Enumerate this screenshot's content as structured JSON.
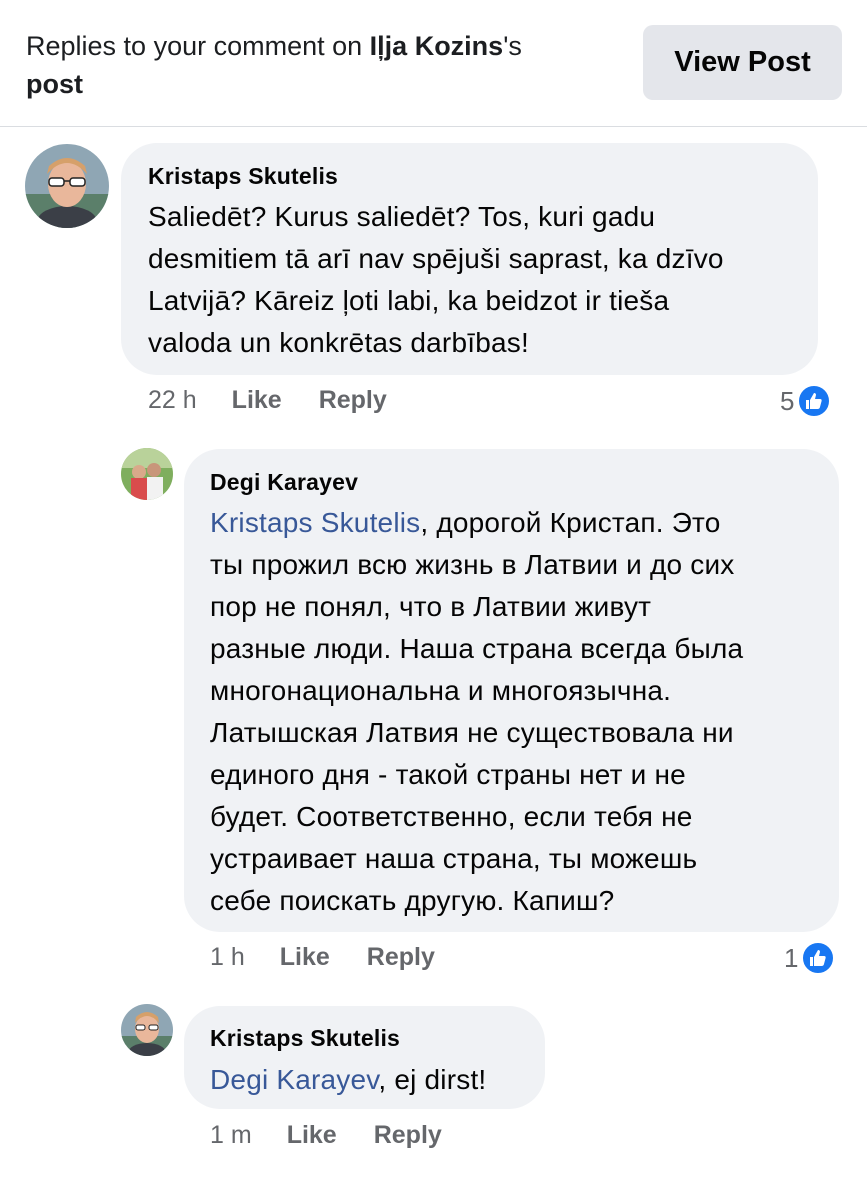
{
  "header": {
    "prefix": "Replies to your comment on ",
    "post_author": "Iļja Kozins",
    "suffix": "'s",
    "post_word": "post",
    "view_post_label": "View Post"
  },
  "comments": [
    {
      "author": "Kristaps Skutelis",
      "text_line1": "Saliedēt? Kurus saliedēt? Tos, kuri gadu",
      "text_line2": "desmitiem tā arī nav spējuši saprast, ka dzīvo",
      "text_line3": "Latvijā? Kāreiz ļoti labi, ka beidzot ir tieša",
      "text_line4": "valoda un konkrētas darbības!",
      "time": "22 h",
      "like_label": "Like",
      "reply_label": "Reply",
      "reactions": "5"
    },
    {
      "author": "Degi Karayev",
      "mention": "Kristaps Skutelis",
      "text_line1_rest": ", дорогой Кристап. Это",
      "text_line2": "ты прожил всю жизнь в Латвии и до сих",
      "text_line3": "пор не понял, что в Латвии живут",
      "text_line4": "разные люди. Наша страна всегда была",
      "text_line5": "многонациональна и многоязычна.",
      "text_line6": "Латышская Латвия не существовала ни",
      "text_line7": "единого дня - такой страны нет и не",
      "text_line8": "будет. Соответственно, если тебя не",
      "text_line9": "устраивает наша страна, ты можешь",
      "text_line10": "себе поискать другую. Капиш?",
      "time": "1 h",
      "like_label": "Like",
      "reply_label": "Reply",
      "reactions": "1"
    },
    {
      "author": "Kristaps Skutelis",
      "mention": "Degi Karayev",
      "text_rest": ", ej dirst!",
      "time": "1 m",
      "like_label": "Like",
      "reply_label": "Reply"
    }
  ],
  "icons": {
    "like_reaction": "like-thumb-icon"
  },
  "colors": {
    "bubble": "#f0f2f5",
    "mention": "#385898",
    "like_blue": "#1877f2",
    "meta_gray": "#65676b",
    "button_gray": "#e4e6eb"
  }
}
